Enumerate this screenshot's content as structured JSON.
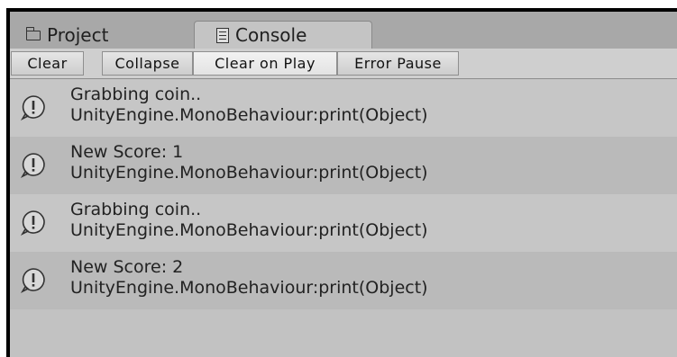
{
  "tabs": [
    {
      "label": "Project",
      "icon": "folder-icon"
    },
    {
      "label": "Console",
      "icon": "console-icon"
    }
  ],
  "toolbar": {
    "clear": "Clear",
    "collapse": "Collapse",
    "clear_on_play": "Clear on Play",
    "error_pause": "Error Pause"
  },
  "logs": [
    {
      "message": "Grabbing coin..",
      "trace": "UnityEngine.MonoBehaviour:print(Object)",
      "icon": "info-icon"
    },
    {
      "message": "New Score: 1",
      "trace": "UnityEngine.MonoBehaviour:print(Object)",
      "icon": "info-icon"
    },
    {
      "message": "Grabbing coin..",
      "trace": "UnityEngine.MonoBehaviour:print(Object)",
      "icon": "info-icon"
    },
    {
      "message": "New Score: 2",
      "trace": "UnityEngine.MonoBehaviour:print(Object)",
      "icon": "info-icon"
    }
  ]
}
